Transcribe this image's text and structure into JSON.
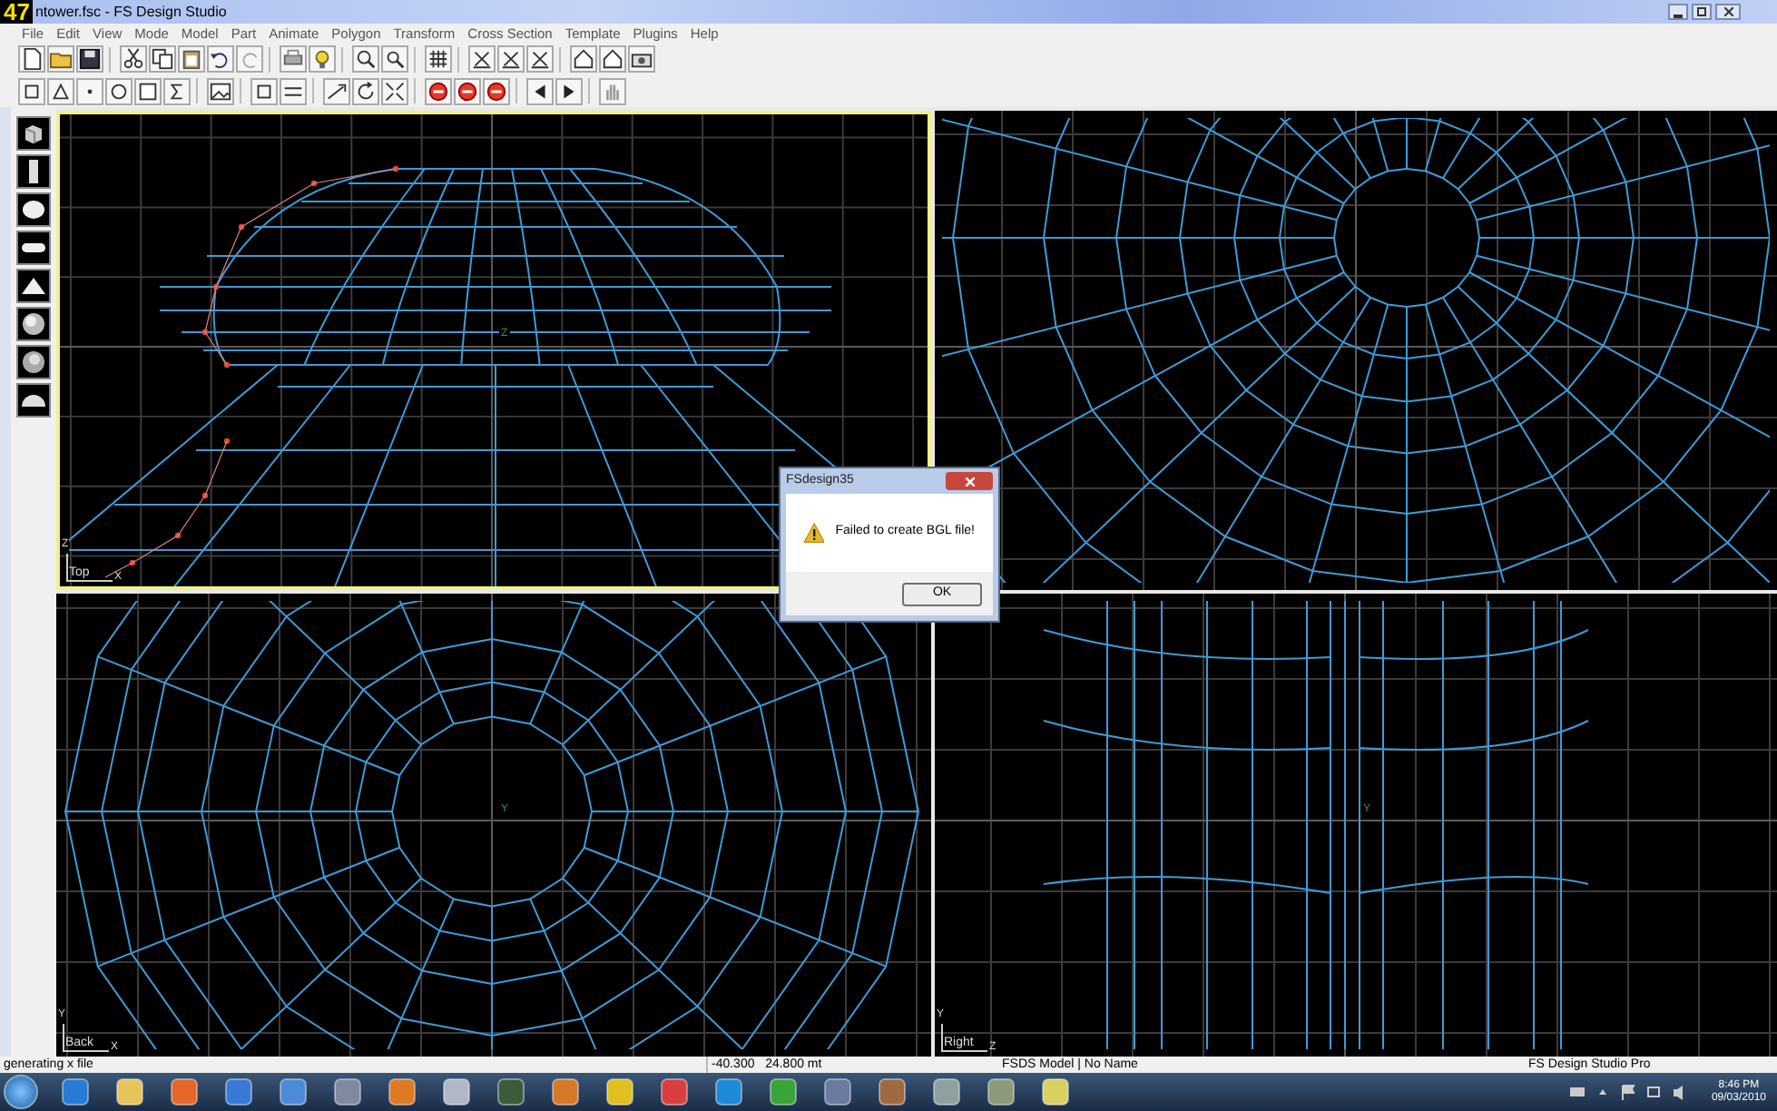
{
  "fps_counter": "47",
  "window": {
    "title": "ntower.fsc - FS Design Studio"
  },
  "menu": [
    "File",
    "Edit",
    "View",
    "Mode",
    "Model",
    "Part",
    "Animate",
    "Polygon",
    "Transform",
    "Cross Section",
    "Template",
    "Plugins",
    "Help"
  ],
  "viewports": [
    {
      "kind": "dome-side",
      "label": "Top",
      "axis_vertical": "Z",
      "axis_horizontal": "X",
      "center_label": "Z",
      "selected": true
    },
    {
      "kind": "rings-closeup",
      "selected": false
    },
    {
      "kind": "rings-front",
      "label": "Back",
      "axis_vertical": "Y",
      "axis_horizontal": "X",
      "center_label": "Y",
      "selected": false
    },
    {
      "kind": "columns-side",
      "label": "Right",
      "axis_vertical": "Y",
      "axis_horizontal": "Z",
      "center_label": "Y",
      "selected": false
    }
  ],
  "dialog": {
    "title": "FSdesign35",
    "message": "Failed to create BGL file!",
    "button": "OK"
  },
  "status_bar": [
    "generating x file",
    "-40.300   24.800 mt",
    "FSDS Model | No Name",
    "FS Design Studio Pro"
  ],
  "taskbar": {
    "time": "8:46 PM",
    "date": "09/03/2010"
  }
}
